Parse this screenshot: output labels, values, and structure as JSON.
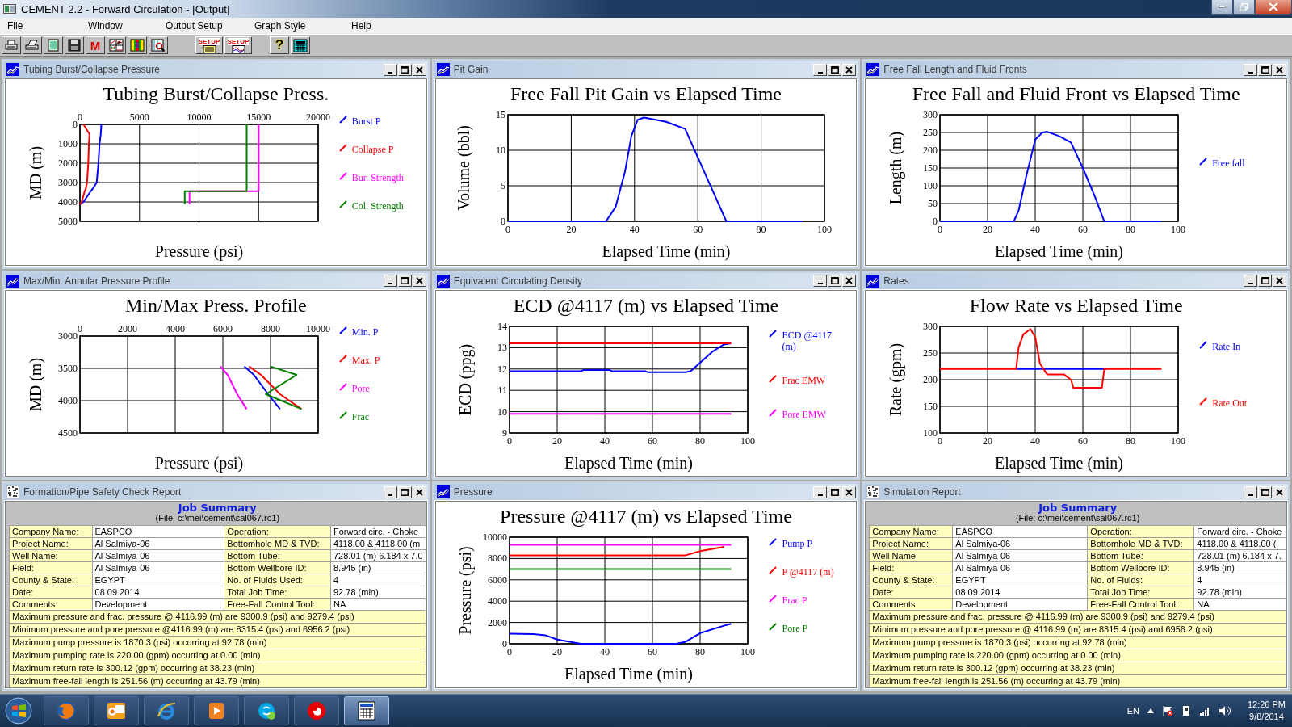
{
  "window": {
    "title": "CEMENT 2.2 - Forward Circulation - [Output]"
  },
  "menu": [
    "File",
    "Window",
    "Output Setup",
    "Graph Style",
    "Help"
  ],
  "toolbar": [
    {
      "kind": "printer"
    },
    {
      "kind": "printer-setup"
    },
    {
      "kind": "clipboard"
    },
    {
      "kind": "floppy"
    },
    {
      "kind": "letter",
      "label": "M"
    },
    {
      "kind": "chart-grid"
    },
    {
      "kind": "pipe"
    },
    {
      "kind": "magnifier"
    },
    {
      "kind": "setup-list",
      "label": "SETUP"
    },
    {
      "kind": "setup-chart",
      "label": "SETUP"
    },
    {
      "kind": "help",
      "label": "?"
    },
    {
      "kind": "calculator"
    }
  ],
  "panels": [
    {
      "kind": "chart",
      "title": "Tubing Burst/Collapse Pressure",
      "chart_data": {
        "type": "line",
        "title": "Tubing Burst/Collapse Press.",
        "xlabel": "Pressure (psi)",
        "ylabel": "MD (m)",
        "orientation": "horizontal",
        "grid": true,
        "legend": "right",
        "xlim": [
          0,
          20000
        ],
        "ylim": [
          5000,
          0
        ],
        "xticks": [
          0,
          5000,
          10000,
          15000,
          20000
        ],
        "yticks": [
          0,
          1000,
          2000,
          3000,
          4000,
          5000
        ],
        "x": [
          0,
          500,
          1000,
          2000,
          3000,
          3300,
          3450,
          3450,
          4000,
          4118
        ],
        "series": [
          {
            "name": "Burst P",
            "color": "#0000ff",
            "values": [
              1800,
              1750,
              1650,
              1550,
              1400,
              1100,
              900,
              900,
              300,
              0
            ]
          },
          {
            "name": "Collapse P",
            "color": "#ff0000",
            "values": [
              300,
              800,
              750,
              700,
              600,
              500,
              400,
              400,
              150,
              0
            ]
          },
          {
            "name": "Bur. Strength",
            "color": "#ff00ff",
            "values": [
              15000,
              15000,
              15000,
              15000,
              15000,
              15000,
              15000,
              9200,
              9200,
              9200
            ]
          },
          {
            "name": "Col. Strength",
            "color": "#008000",
            "values": [
              14000,
              14000,
              14000,
              14000,
              14000,
              14000,
              14000,
              8800,
              8800,
              8800
            ]
          }
        ]
      }
    },
    {
      "kind": "chart",
      "title": "Pit Gain",
      "chart_data": {
        "type": "line",
        "title": "Free Fall Pit Gain vs Elapsed Time",
        "xlabel": "Elapsed Time (min)",
        "ylabel": "Volume (bbl)",
        "grid": true,
        "xlim": [
          0,
          100
        ],
        "ylim": [
          0,
          15
        ],
        "xticks": [
          0,
          20,
          40,
          60,
          80,
          100
        ],
        "yticks": [
          0,
          5,
          10,
          15
        ],
        "x": [
          0,
          31,
          34,
          37,
          39,
          41,
          43,
          50,
          56,
          60,
          65,
          69,
          93
        ],
        "series": [
          {
            "color": "#0000ff",
            "values": [
              0,
              0,
              2,
              7,
              12,
              14.3,
              14.6,
              14,
              13,
              9,
              4,
              0,
              0
            ]
          }
        ]
      }
    },
    {
      "kind": "chart",
      "title": "Free Fall Length and Fluid Fronts",
      "chart_data": {
        "type": "line",
        "title": "Free Fall and Fluid Front vs Elapsed Time",
        "xlabel": "Elapsed Time (min)",
        "ylabel": "Length (m)",
        "grid": true,
        "legend": "right",
        "xlim": [
          0,
          100
        ],
        "ylim": [
          0,
          300
        ],
        "xticks": [
          0,
          20,
          40,
          60,
          80,
          100
        ],
        "yticks": [
          0,
          50,
          100,
          150,
          200,
          250,
          300
        ],
        "x": [
          0,
          31,
          33,
          36,
          40,
          43,
          45,
          50,
          55,
          60,
          65,
          69,
          93
        ],
        "series": [
          {
            "name": "Free fall",
            "color": "#0000ff",
            "values": [
              0,
              0,
              30,
              120,
              230,
              250,
              252,
              240,
              222,
              150,
              70,
              0,
              0
            ]
          }
        ]
      }
    },
    {
      "kind": "chart",
      "title": "Max/Min. Annular Pressure Profile",
      "chart_data": {
        "type": "line",
        "title": "Min/Max Press. Profile",
        "xlabel": "Pressure (psi)",
        "ylabel": "MD (m)",
        "orientation": "horizontal",
        "grid": true,
        "legend": "right",
        "xlim": [
          0,
          10000
        ],
        "ylim": [
          4500,
          3000
        ],
        "xticks": [
          0,
          2000,
          4000,
          6000,
          8000,
          10000
        ],
        "yticks": [
          3000,
          3500,
          4000,
          4500
        ],
        "x": [
          3470,
          3600,
          3900,
          4130
        ],
        "series": [
          {
            "name": "Min. P",
            "color": "#0000ff",
            "values": [
              6900,
              7300,
              7900,
              8400
            ]
          },
          {
            "name": "Max. P",
            "color": "#ff0000",
            "values": [
              7100,
              7600,
              8400,
              9300
            ]
          },
          {
            "name": "Pore",
            "color": "#ff00ff",
            "values": [
              5900,
              6200,
              6600,
              7000
            ]
          },
          {
            "name": "Frac",
            "color": "#008000",
            "values": [
              8000,
              9100,
              7800,
              9300
            ]
          }
        ]
      }
    },
    {
      "kind": "chart",
      "title": "Equivalent Circulating Density",
      "chart_data": {
        "type": "line",
        "title": "ECD @4117 (m) vs Elapsed Time",
        "xlabel": "Elapsed Time (min)",
        "ylabel": "ECD (ppg)",
        "grid": true,
        "legend": "right",
        "xlim": [
          0,
          100
        ],
        "ylim": [
          9,
          14
        ],
        "xticks": [
          0,
          20,
          40,
          60,
          80,
          100
        ],
        "yticks": [
          9,
          10,
          11,
          12,
          13,
          14
        ],
        "x": [
          0,
          30,
          31,
          42,
          43,
          57,
          58,
          74,
          76,
          80,
          85,
          90,
          93
        ],
        "series": [
          {
            "name": "ECD @4117 (m)",
            "color": "#0000ff",
            "values": [
              11.9,
              11.9,
              11.95,
              11.95,
              11.9,
              11.9,
              11.85,
              11.85,
              11.9,
              12.3,
              12.8,
              13.15,
              13.2
            ]
          },
          {
            "name": "Frac EMW",
            "color": "#ff0000",
            "values": [
              13.2,
              13.2,
              13.2,
              13.2,
              13.2,
              13.2,
              13.2,
              13.2,
              13.2,
              13.2,
              13.2,
              13.2,
              13.2
            ]
          },
          {
            "name": "Pore EMW",
            "color": "#ff00ff",
            "values": [
              9.9,
              9.9,
              9.9,
              9.9,
              9.9,
              9.9,
              9.9,
              9.9,
              9.9,
              9.9,
              9.9,
              9.9,
              9.9
            ]
          }
        ]
      }
    },
    {
      "kind": "chart",
      "title": "Rates",
      "chart_data": {
        "type": "line",
        "title": "Flow Rate vs Elapsed Time",
        "xlabel": "Elapsed Time (min)",
        "ylabel": "Rate (gpm)",
        "grid": true,
        "legend": "right",
        "xlim": [
          0,
          100
        ],
        "ylim": [
          100,
          300
        ],
        "xticks": [
          0,
          20,
          40,
          60,
          80,
          100
        ],
        "yticks": [
          100,
          150,
          200,
          250,
          300
        ],
        "x": [
          0,
          32,
          33,
          35,
          38,
          40,
          42,
          45,
          52,
          55,
          56,
          60,
          68,
          69,
          70,
          93
        ],
        "series": [
          {
            "name": "Rate In",
            "color": "#0000ff",
            "values": [
              null,
              220,
              220,
              220,
              220,
              220,
              220,
              220,
              220,
              220,
              220,
              220,
              220,
              220,
              220,
              null
            ]
          },
          {
            "name": "Rate Out",
            "color": "#ff0000",
            "values": [
              220,
              220,
              260,
              285,
              295,
              280,
              230,
              210,
              210,
              200,
              185,
              185,
              185,
              220,
              220,
              220
            ]
          }
        ]
      }
    },
    {
      "kind": "report",
      "title": "Formation/Pipe Safety Check Report",
      "heading": "Job Summary",
      "file": "(File: c:\\mei\\cement\\sal067.rc1)",
      "rows": [
        [
          "Company Name:",
          "EASPCO",
          "Operation:",
          "Forward circ. - Choke"
        ],
        [
          "Project Name:",
          "Al Salmiya-06",
          "Bottomhole MD & TVD:",
          "4118.00 & 4118.00 (m"
        ],
        [
          "Well Name:",
          "Al Salmiya-06",
          "Bottom Tube:",
          "728.01 (m) 6.184 x 7.0"
        ],
        [
          "Field:",
          "Al Salmiya-06",
          "Bottom Wellbore ID:",
          "8.945 (in)"
        ],
        [
          "County & State:",
          "EGYPT",
          "No. of Fluids Used:",
          "4"
        ],
        [
          "Date:",
          "08 09 2014",
          "Total Job Time:",
          "92.78 (min)"
        ],
        [
          "Comments:",
          "Development",
          "Free-Fall Control Tool:",
          "NA"
        ]
      ],
      "notes": [
        "Maximum pressure and frac. pressure @ 4116.99 (m) are 9300.9 (psi) and 9279.4 (psi)",
        "Minimum pressure and pore pressure @4116.99 (m) are 8315.4 (psi) and 6956.2 (psi)",
        "Maximum pump pressure is 1870.3 (psi) occurring at 92.78 (min)",
        "Maximum pumping rate is 220.00 (gpm) occurring at 0.00 (min)",
        "Maximum return rate is 300.12 (gpm) occurring at 38.23 (min)",
        "Maximum free-fall length is 251.56 (m) occurring at 43.79 (min)"
      ]
    },
    {
      "kind": "chart",
      "title": "Pressure",
      "chart_data": {
        "type": "line",
        "title": "Pressure @4117 (m) vs Elapsed Time",
        "xlabel": "Elapsed Time (min)",
        "ylabel": "Pressure (psi)",
        "grid": true,
        "legend": "right",
        "xlim": [
          0,
          100
        ],
        "ylim": [
          0,
          10000
        ],
        "xticks": [
          0,
          20,
          40,
          60,
          80,
          100
        ],
        "yticks": [
          0,
          2000,
          4000,
          6000,
          8000,
          10000
        ],
        "x": [
          0,
          10,
          15,
          20,
          30,
          40,
          60,
          70,
          74,
          80,
          90,
          93
        ],
        "series": [
          {
            "name": "Pump P",
            "color": "#0000ff",
            "values": [
              950,
              900,
              800,
              400,
              0,
              0,
              0,
              0,
              200,
              1000,
              1700,
              1870
            ]
          },
          {
            "name": "P @4117 (m)",
            "color": "#ff0000",
            "values": [
              8300,
              8300,
              8300,
              8300,
              8300,
              8300,
              8300,
              8300,
              8300,
              8700,
              9100,
              null
            ]
          },
          {
            "name": "Frac P",
            "color": "#ff00ff",
            "values": [
              9280,
              9280,
              9280,
              9280,
              9280,
              9280,
              9280,
              9280,
              9280,
              9280,
              9280,
              9280
            ]
          },
          {
            "name": "Pore P",
            "color": "#008000",
            "values": [
              7000,
              7000,
              7000,
              7000,
              7000,
              7000,
              7000,
              7000,
              7000,
              7000,
              7000,
              7000
            ]
          }
        ]
      }
    },
    {
      "kind": "report",
      "title": "Simulation Report",
      "heading": "Job Summary",
      "file": "(File: c:\\mei\\cement\\sal067.rc1)",
      "rows": [
        [
          "Company Name:",
          "EASPCO",
          "Operation:",
          "Forward circ. - Choke"
        ],
        [
          "Project Name:",
          "Al Salmiya-06",
          "Bottomhole MD & TVD:",
          "4118.00 & 4118.00 ("
        ],
        [
          "Well Name:",
          "Al Salmiya-06",
          "Bottom Tube:",
          "728.01 (m) 6.184 x 7."
        ],
        [
          "Field:",
          "Al Salmiya-06",
          "Bottom Wellbore ID:",
          "8.945 (in)"
        ],
        [
          "County & State:",
          "EGYPT",
          "No. of Fluids:",
          "4"
        ],
        [
          "Date:",
          "08 09 2014",
          "Total Job Time:",
          "92.78 (min)"
        ],
        [
          "Comments:",
          "Development",
          "Free-Fall Control Tool:",
          "NA"
        ]
      ],
      "notes": [
        "Maximum pressure and frac. pressure @ 4116.99 (m) are 9300.9 (psi) and 9279.4 (psi)",
        "Minimum pressure and pore pressure @ 4116.99 (m) are 8315.4 (psi) and 6956.2 (psi)",
        "Maximum pump pressure is 1870.3 (psi) occurring at 92.78 (min)",
        "Maximum pumping rate is 220.00 (gpm) occurring at 0.00 (min)",
        "Maximum return rate is 300.12 (gpm) occurring at 38.23 (min)",
        "Maximum free-fall length is 251.56 (m) occurring at 43.79 (min)"
      ]
    }
  ],
  "taskbar": {
    "apps": [
      {
        "kind": "browser",
        "selected": false
      },
      {
        "kind": "mail",
        "selected": false
      },
      {
        "kind": "globe",
        "selected": false
      },
      {
        "kind": "player",
        "selected": false
      },
      {
        "kind": "chat",
        "selected": false
      },
      {
        "kind": "red-circle",
        "selected": false
      },
      {
        "kind": "calculator",
        "selected": true
      }
    ],
    "language": "EN",
    "time": "12:26 PM",
    "date": "9/8/2014"
  }
}
